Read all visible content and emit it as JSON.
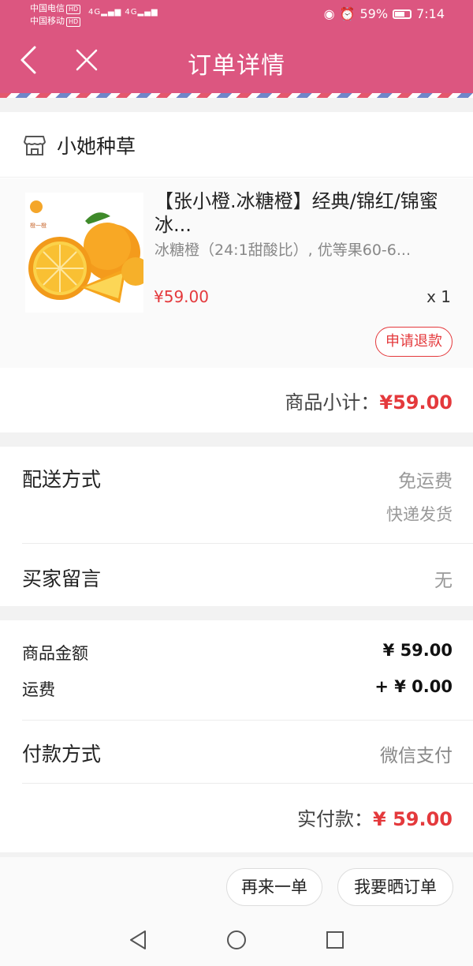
{
  "status_bar": {
    "carrier_1": "中国电信",
    "carrier_2": "中国移动",
    "hd": "HD",
    "network": "4G",
    "battery": "59%",
    "time": "7:14"
  },
  "header": {
    "title": "订单详情",
    "back_icon": "chevron-left-icon",
    "close_icon": "close-icon"
  },
  "shop": {
    "name": "小她种草",
    "icon": "store-icon"
  },
  "product": {
    "title": "【张小橙.冰糖橙】经典/锦红/锦蜜冰...",
    "spec": "冰糖橙（24:1甜酸比）, 优等果60-6...",
    "price": "¥59.00",
    "quantity": "x 1",
    "refund_label": "申请退款",
    "image_caption": "橙一橙"
  },
  "subtotal": {
    "label": "商品小计：",
    "amount": "¥59.00"
  },
  "delivery": {
    "label": "配送方式",
    "value": "免运费",
    "sub": "快递发货"
  },
  "message": {
    "label": "买家留言",
    "value": "无"
  },
  "amounts": {
    "goods_label": "商品金额",
    "goods_value": "¥ 59.00",
    "freight_label": "运费",
    "freight_value": "+ ¥ 0.00"
  },
  "payment": {
    "label": "付款方式",
    "value": "微信支付"
  },
  "paid": {
    "label": "实付款：",
    "amount": "¥ 59.00"
  },
  "actions": {
    "again": "再来一单",
    "show": "我要晒订单"
  },
  "colors": {
    "header": "#dc5680",
    "price": "#e4393c"
  }
}
